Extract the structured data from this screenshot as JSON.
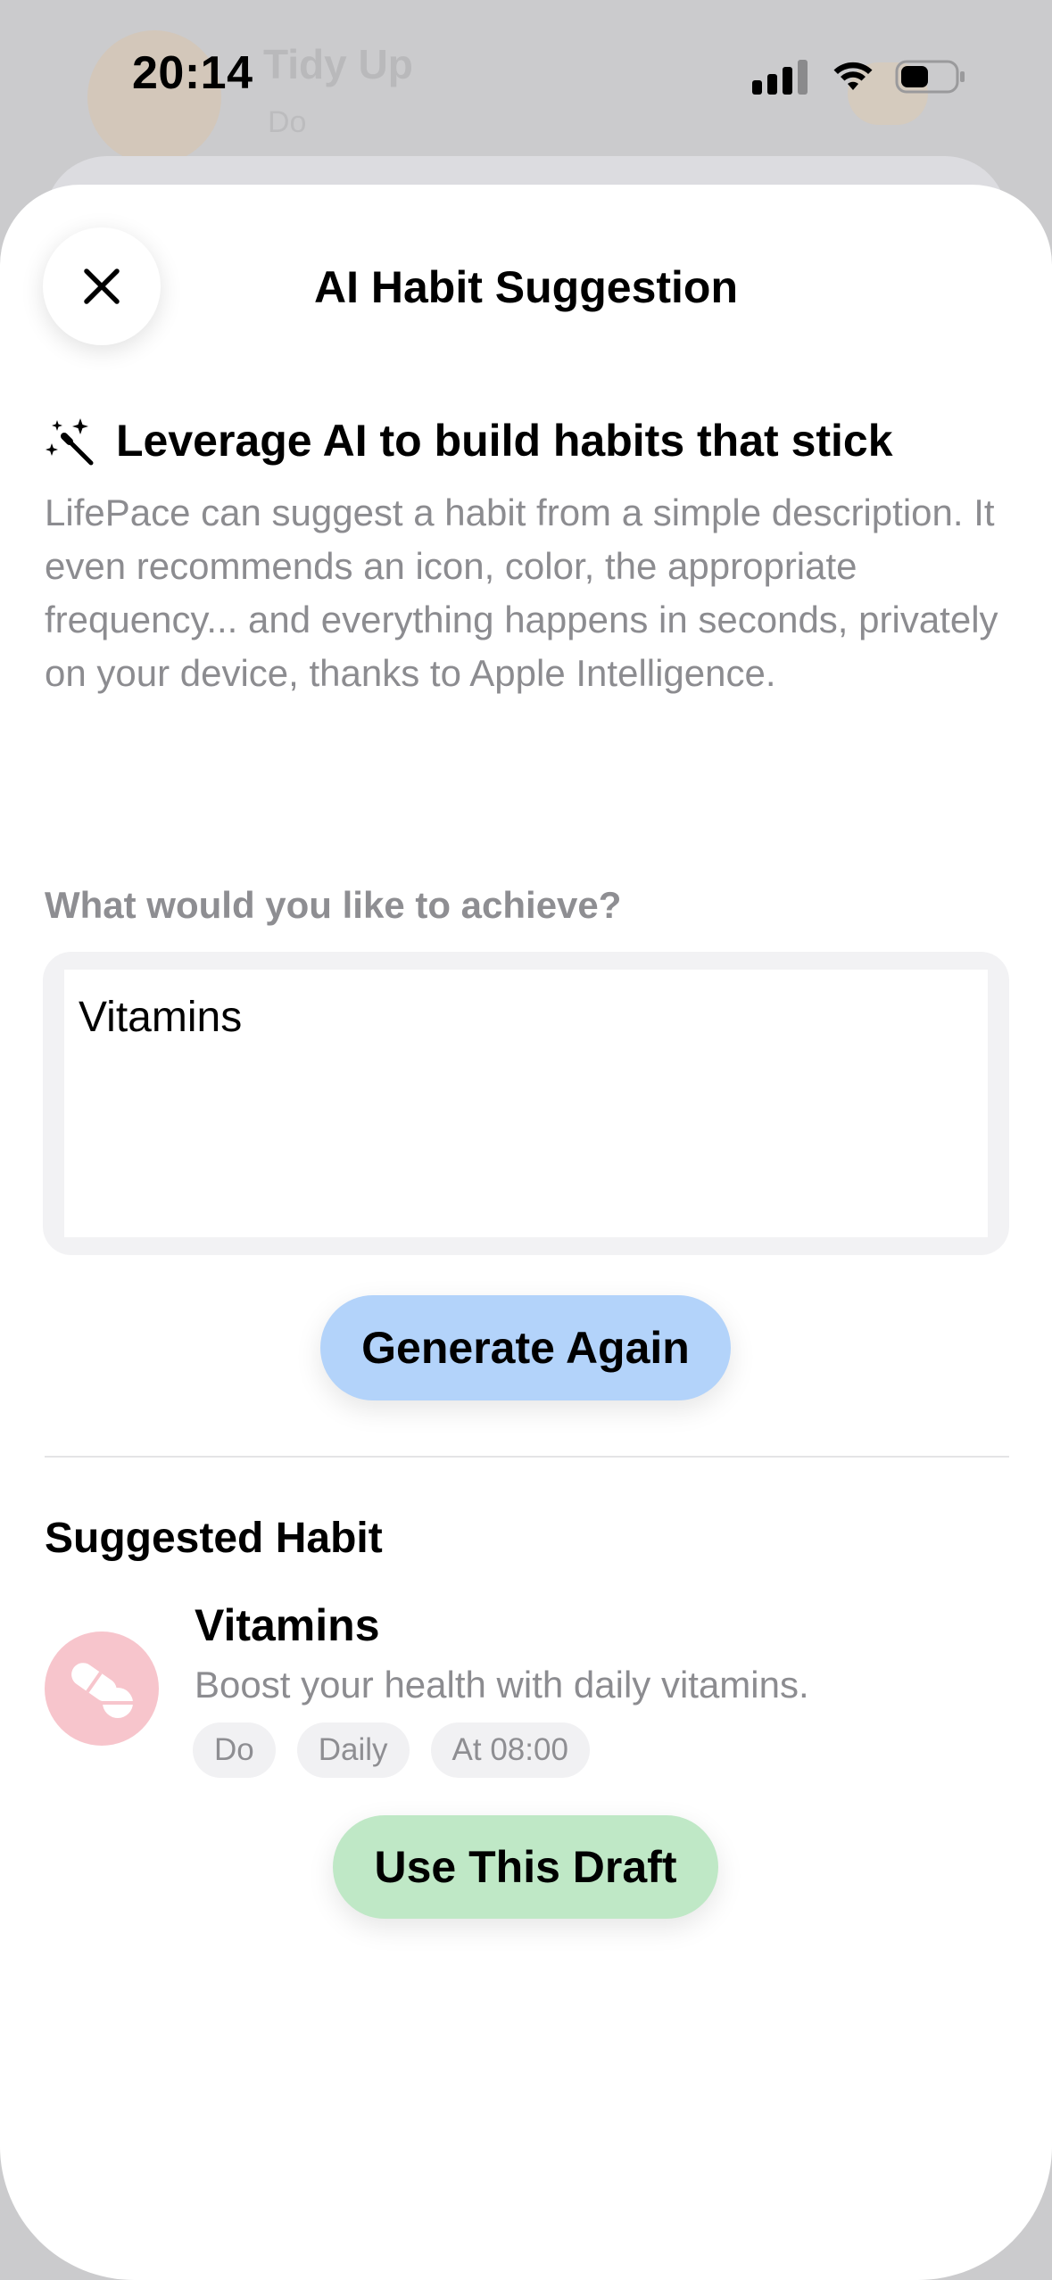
{
  "status_bar": {
    "time": "20:14"
  },
  "background": {
    "title": "Tidy Up",
    "subtitle": "Do"
  },
  "sheet": {
    "title": "AI Habit Suggestion",
    "close_icon": "close-icon"
  },
  "intro": {
    "icon": "magic-wand-icon",
    "heading": "Leverage AI to build habits that stick",
    "body": "LifePace can suggest a habit from a simple description. It even recommends an icon, color, the appropriate frequency... and everything happens in seconds, privately on your device, thanks to Apple Intelligence."
  },
  "prompt": {
    "label": "What would you like to achieve?",
    "value": "Vitamins"
  },
  "generate_button": {
    "label": "Generate Again",
    "color": "#b3d3fa"
  },
  "suggestion": {
    "heading": "Suggested Habit",
    "icon": "pills-icon",
    "icon_color": "#f7c5cc",
    "name": "Vitamins",
    "description": "Boost your health with daily vitamins.",
    "chips": [
      "Do",
      "Daily",
      "At 08:00"
    ]
  },
  "use_button": {
    "label": "Use This Draft",
    "color": "#bfe8c6"
  }
}
